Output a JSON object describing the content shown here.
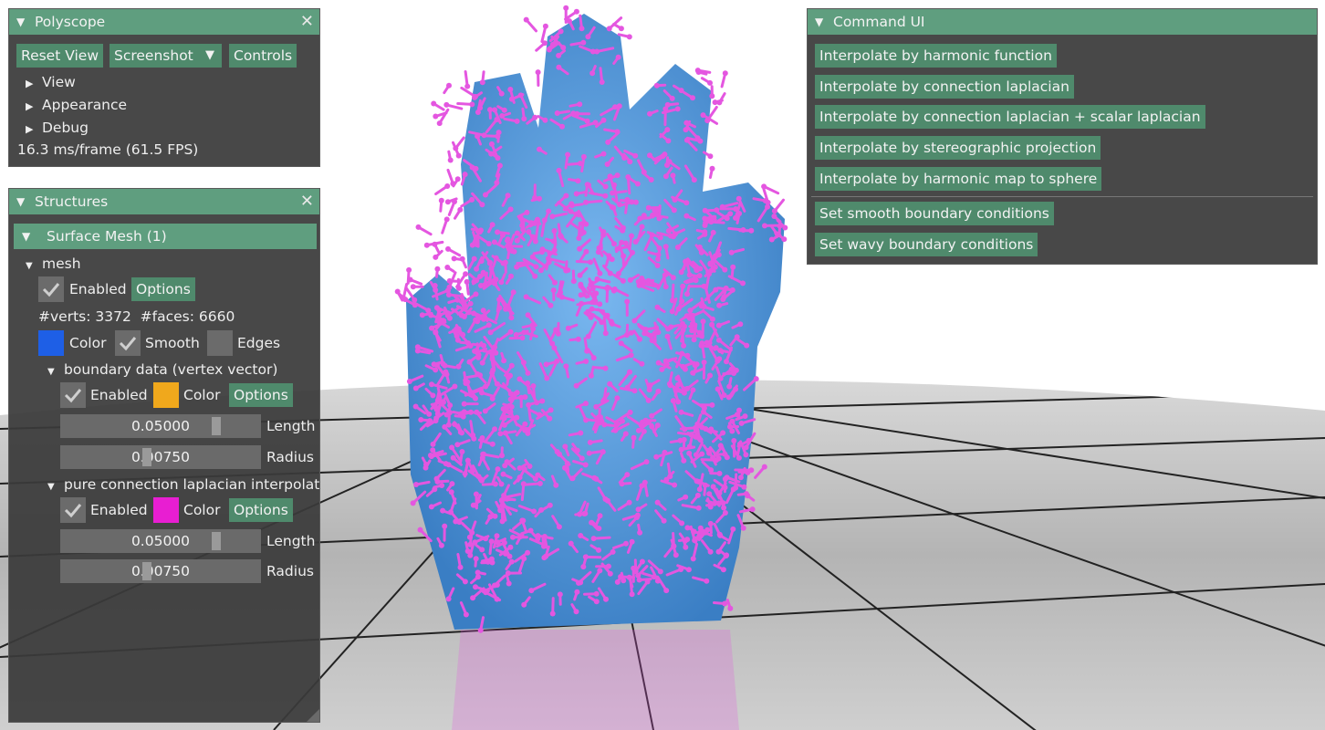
{
  "polyscope": {
    "title": "Polyscope",
    "buttons": {
      "reset_view": "Reset View",
      "screenshot": "Screenshot",
      "controls": "Controls"
    },
    "tree": [
      "View",
      "Appearance",
      "Debug"
    ],
    "fps": "16.3 ms/frame (61.5 FPS)"
  },
  "structures": {
    "title": "Structures",
    "group_header": "Surface Mesh (1)",
    "mesh_name": "mesh",
    "enabled_label": "Enabled",
    "options_label": "Options",
    "stats": "#verts: 3372  #faces: 6660",
    "color_label": "Color",
    "smooth_label": "Smooth",
    "edges_label": "Edges",
    "mesh_color": "#1e5fe6",
    "quantities": [
      {
        "name": "boundary data (vertex vector)",
        "enabled_label": "Enabled",
        "color_label": "Color",
        "options_label": "Options",
        "color": "#f0a81c",
        "length_value": "0.05000",
        "length_label": "Length",
        "radius_value": "0.00750",
        "radius_label": "Radius"
      },
      {
        "name": "pure connection laplacian interpolatic",
        "enabled_label": "Enabled",
        "color_label": "Color",
        "options_label": "Options",
        "color": "#e81ed2",
        "length_value": "0.05000",
        "length_label": "Length",
        "radius_value": "0.00750",
        "radius_label": "Radius"
      }
    ]
  },
  "command_ui": {
    "title": "Command UI",
    "buttons": [
      "Interpolate by harmonic function",
      "Interpolate by connection laplacian",
      "Interpolate by connection laplacian + scalar laplacian",
      "Interpolate by stereographic projection",
      "Interpolate by harmonic map to sphere"
    ],
    "boundary_buttons": [
      "Set smooth boundary conditions",
      "Set wavy boundary conditions"
    ]
  },
  "scene_colors": {
    "surface": "#4f95d8",
    "arrows": "#e456e0",
    "ground": "#bdbdbd"
  }
}
